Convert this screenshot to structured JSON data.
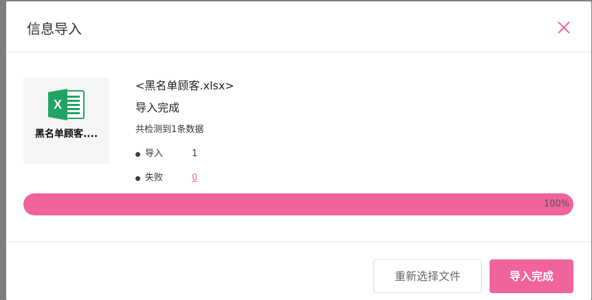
{
  "dialog": {
    "title": "信息导入"
  },
  "file": {
    "card_name": "黑名单顾客....",
    "display_name": "<黑名单顾客.xlsx>",
    "icon": "excel-file-icon"
  },
  "result": {
    "status": "导入完成",
    "detected": "共检测到1条数据",
    "imported_label": "导入",
    "imported_count": "1",
    "failed_label": "失败",
    "failed_count": "0"
  },
  "progress": {
    "value": 100,
    "label": "100%"
  },
  "buttons": {
    "reselect": "重新选择文件",
    "done": "导入完成"
  },
  "colors": {
    "accent": "#f0639c",
    "excel_green": "#21a366"
  }
}
